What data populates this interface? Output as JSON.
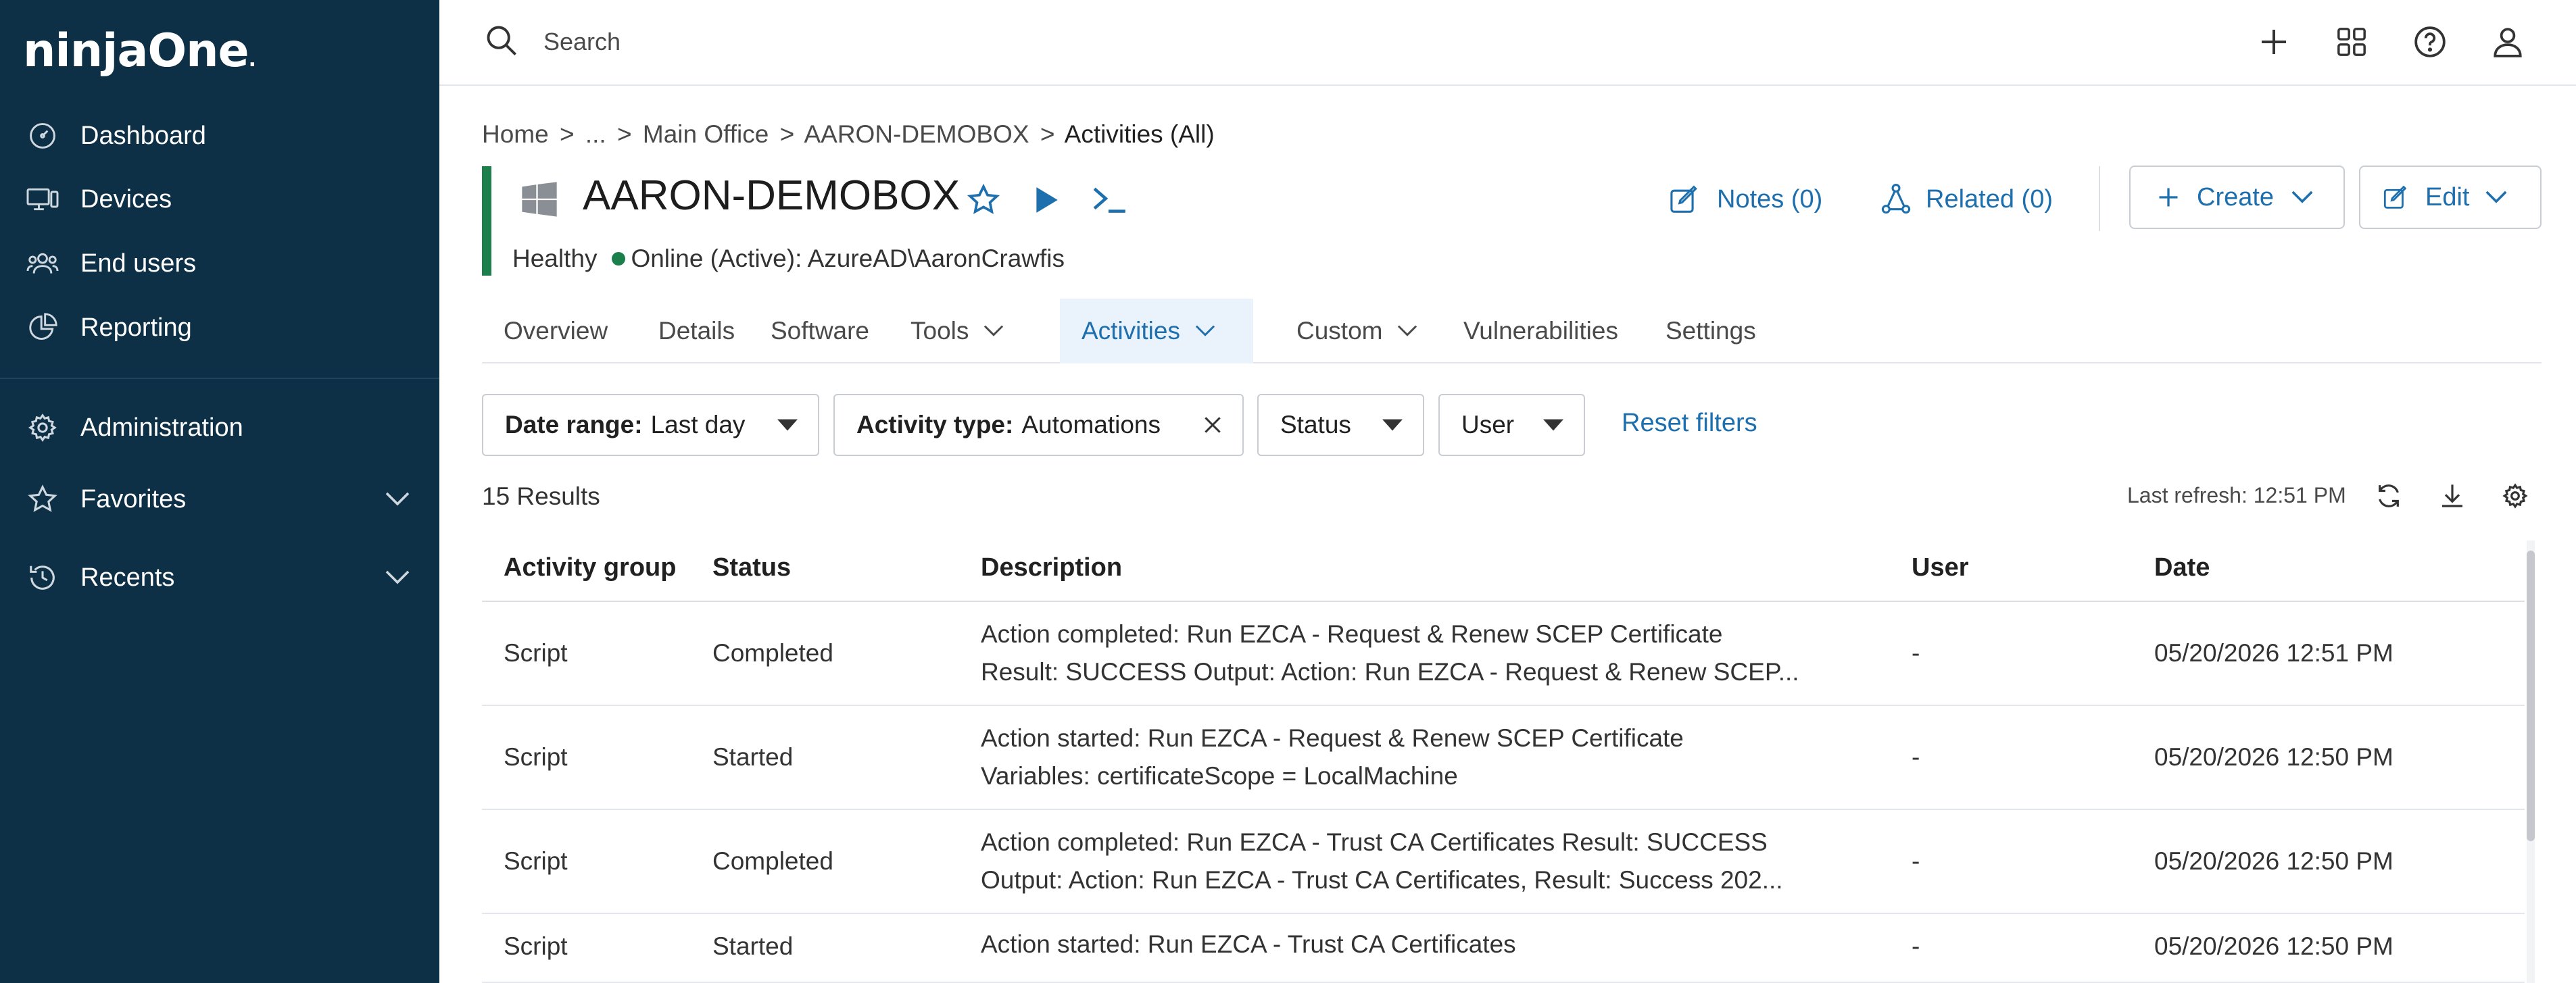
{
  "brand": {
    "logo_text": "ninjaOne",
    "logo_mark": "."
  },
  "sidebar": {
    "items": [
      {
        "label": "Dashboard",
        "icon": "dashboard-icon"
      },
      {
        "label": "Devices",
        "icon": "devices-icon"
      },
      {
        "label": "End users",
        "icon": "users-icon"
      },
      {
        "label": "Reporting",
        "icon": "reporting-icon"
      },
      {
        "label": "Administration",
        "icon": "gear-icon"
      },
      {
        "label": "Favorites",
        "icon": "star-icon"
      },
      {
        "label": "Recents",
        "icon": "history-icon"
      }
    ]
  },
  "topbar": {
    "search_placeholder": "Search"
  },
  "breadcrumb": {
    "home": "Home",
    "sep": ">",
    "ellipsis": "...",
    "office": "Main Office",
    "device": "AARON-DEMOBOX",
    "current": "Activities (All)"
  },
  "device": {
    "name": "AARON-DEMOBOX",
    "health": "Healthy",
    "online": "Online (Active): AzureAD\\AaronCrawfis",
    "notes": "Notes (0)",
    "related": "Related (0)",
    "create": "Create",
    "edit": "Edit"
  },
  "tabs": [
    "Overview",
    "Details",
    "Software",
    "Tools",
    "Activities",
    "Custom",
    "Vulnerabilities",
    "Settings"
  ],
  "filters": {
    "date_range_label": "Date range:",
    "date_range_value": "Last day",
    "activity_type_label": "Activity type:",
    "activity_type_value": "Automations",
    "status": "Status",
    "user": "User",
    "reset": "Reset filters"
  },
  "results": {
    "count": "15 Results",
    "last_refresh": "Last refresh: 12:51 PM"
  },
  "table": {
    "headers": [
      "Activity group",
      "Status",
      "Description",
      "User",
      "Date"
    ],
    "rows": [
      {
        "group": "Script",
        "status": "Completed",
        "desc1": "Action completed: Run EZCA - Request & Renew SCEP Certificate",
        "desc2": "Result: SUCCESS Output: Action: Run EZCA - Request & Renew SCEP...",
        "user": "-",
        "date": "05/20/2026 12:51 PM"
      },
      {
        "group": "Script",
        "status": "Started",
        "desc1": "Action started: Run EZCA - Request & Renew SCEP Certificate",
        "desc2": "Variables: certificateScope = LocalMachine",
        "user": "-",
        "date": "05/20/2026 12:50 PM"
      },
      {
        "group": "Script",
        "status": "Completed",
        "desc1": "Action completed: Run EZCA - Trust CA Certificates Result: SUCCESS",
        "desc2": "Output: Action: Run EZCA - Trust CA Certificates, Result: Success 202...",
        "user": "-",
        "date": "05/20/2026 12:50 PM"
      },
      {
        "group": "Script",
        "status": "Started",
        "desc1": "Action started: Run EZCA - Trust CA Certificates",
        "desc2": "",
        "user": "-",
        "date": "05/20/2026 12:50 PM"
      }
    ]
  },
  "colors": {
    "sidebar": "#0d3047",
    "accent": "#1d6fae",
    "healthy": "#1a7f4b"
  }
}
